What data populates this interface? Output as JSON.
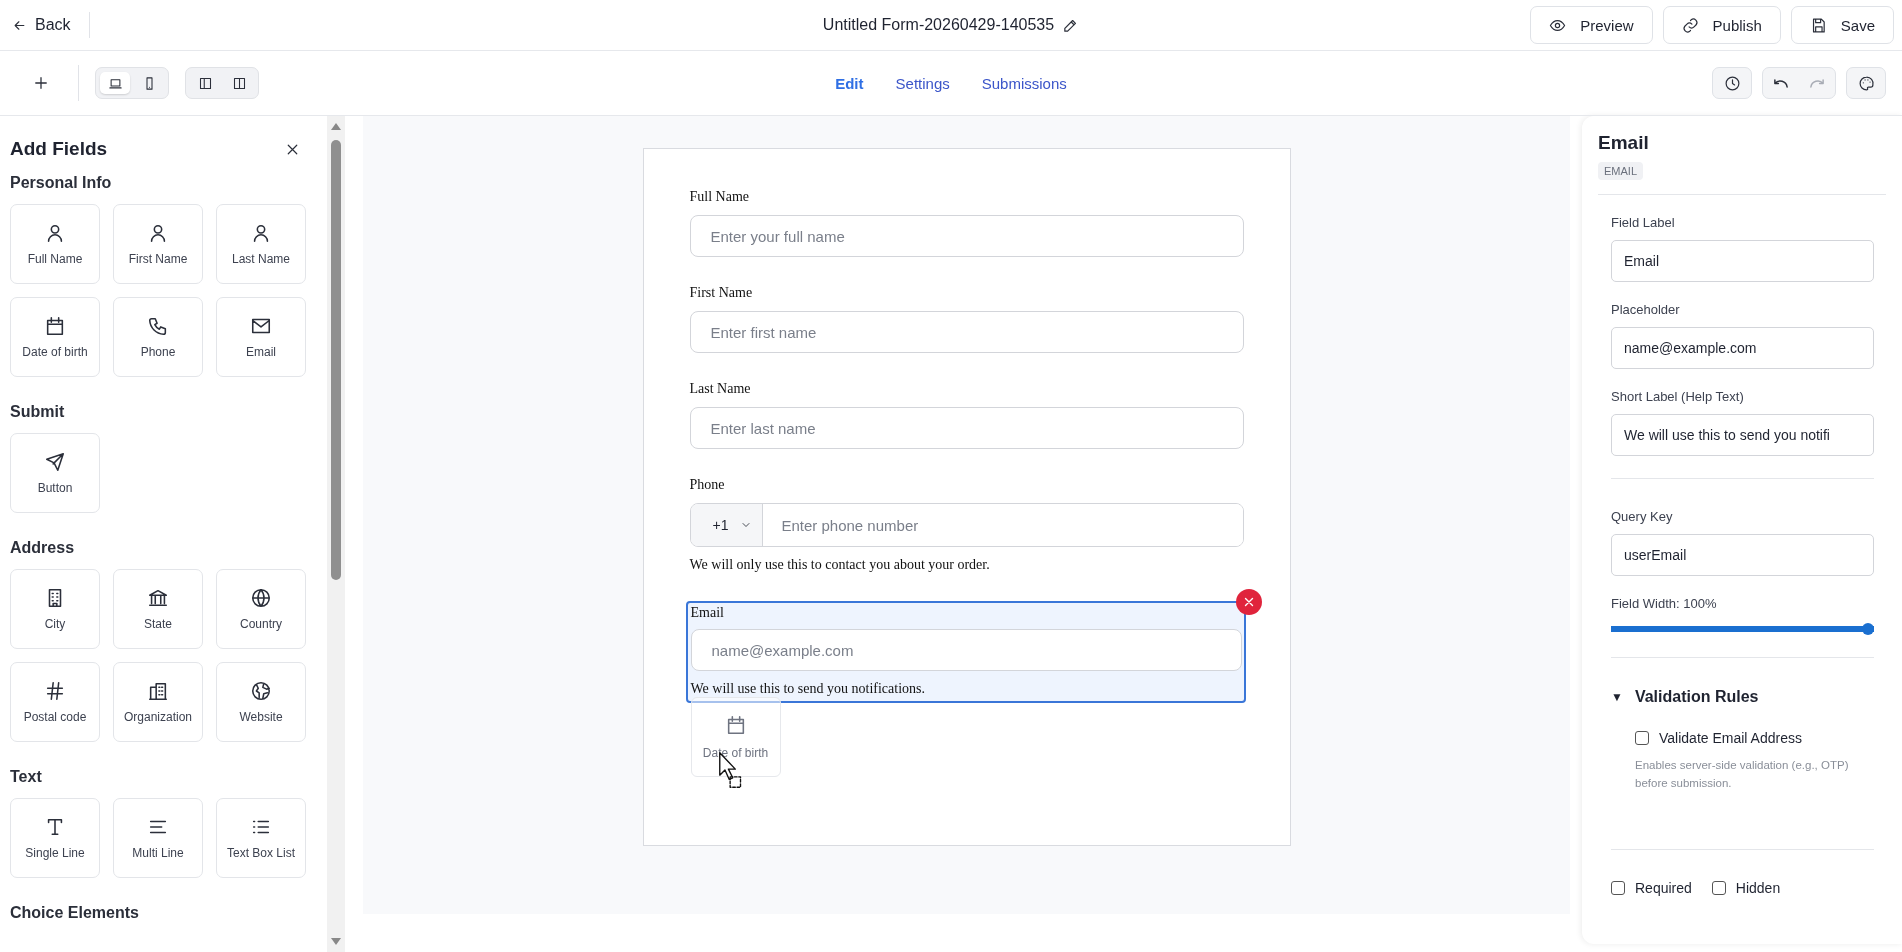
{
  "topbar": {
    "back": "Back",
    "title": "Untitled Form-20260429-140535",
    "actions": [
      "Preview",
      "Publish",
      "Save"
    ]
  },
  "toolbar": {
    "device_modes": [
      {
        "selected": true
      },
      {
        "selected": false
      }
    ],
    "tabs": [
      {
        "label": "Edit",
        "selected": true
      },
      {
        "label": "Settings",
        "selected": false
      },
      {
        "label": "Submissions",
        "selected": false
      }
    ]
  },
  "sidebar": {
    "title": "Add Fields",
    "sections": [
      {
        "title": "Personal Info",
        "items": [
          "Full Name",
          "First Name",
          "Last Name",
          "Date of birth",
          "Phone",
          "Email"
        ]
      },
      {
        "title": "Submit",
        "items": [
          "Button"
        ]
      },
      {
        "title": "Address",
        "items": [
          "City",
          "State",
          "Country",
          "Postal code",
          "Organization",
          "Website"
        ]
      },
      {
        "title": "Text",
        "items": [
          "Single Line",
          "Multi Line",
          "Text Box List"
        ]
      },
      {
        "title": "Choice Elements"
      }
    ]
  },
  "form": {
    "fields": [
      {
        "kind": "text",
        "label": "Full Name",
        "placeholder": "Enter your full name",
        "selected": false
      },
      {
        "kind": "text",
        "label": "First Name",
        "placeholder": "Enter first name",
        "selected": false
      },
      {
        "kind": "text",
        "label": "Last Name",
        "placeholder": "Enter last name",
        "selected": false
      },
      {
        "kind": "phone",
        "label": "Phone",
        "country_code": "+1",
        "placeholder": "Enter phone number",
        "help": "We will only use this to contact you about your order.",
        "selected": false
      },
      {
        "kind": "text",
        "label": "Email",
        "placeholder": "name@example.com",
        "help": "We will use this to send you notifications.",
        "selected": true
      }
    ],
    "drag_ghost": {
      "label": "Date of birth"
    }
  },
  "properties": {
    "title": "Email",
    "type_badge": "EMAIL",
    "fields": [
      {
        "label": "Field Label",
        "value": "Email"
      },
      {
        "label": "Placeholder",
        "value": "name@example.com"
      },
      {
        "label": "Short Label (Help Text)",
        "value": "We will use this to send you notifi"
      }
    ],
    "query_key": {
      "label": "Query Key",
      "value": "userEmail"
    },
    "width": {
      "label": "Field Width: 100%",
      "level": 1
    },
    "validation": {
      "toggle": "▼",
      "title": "Validation Rules",
      "expanded": true,
      "rules": [
        {
          "label": "Validate Email Address",
          "checked": false,
          "description": "Enables server-side validation (e.g., OTP) before submission."
        }
      ]
    },
    "flags": [
      {
        "label": "Required",
        "checked": false
      },
      {
        "label": "Hidden",
        "checked": false
      }
    ]
  }
}
